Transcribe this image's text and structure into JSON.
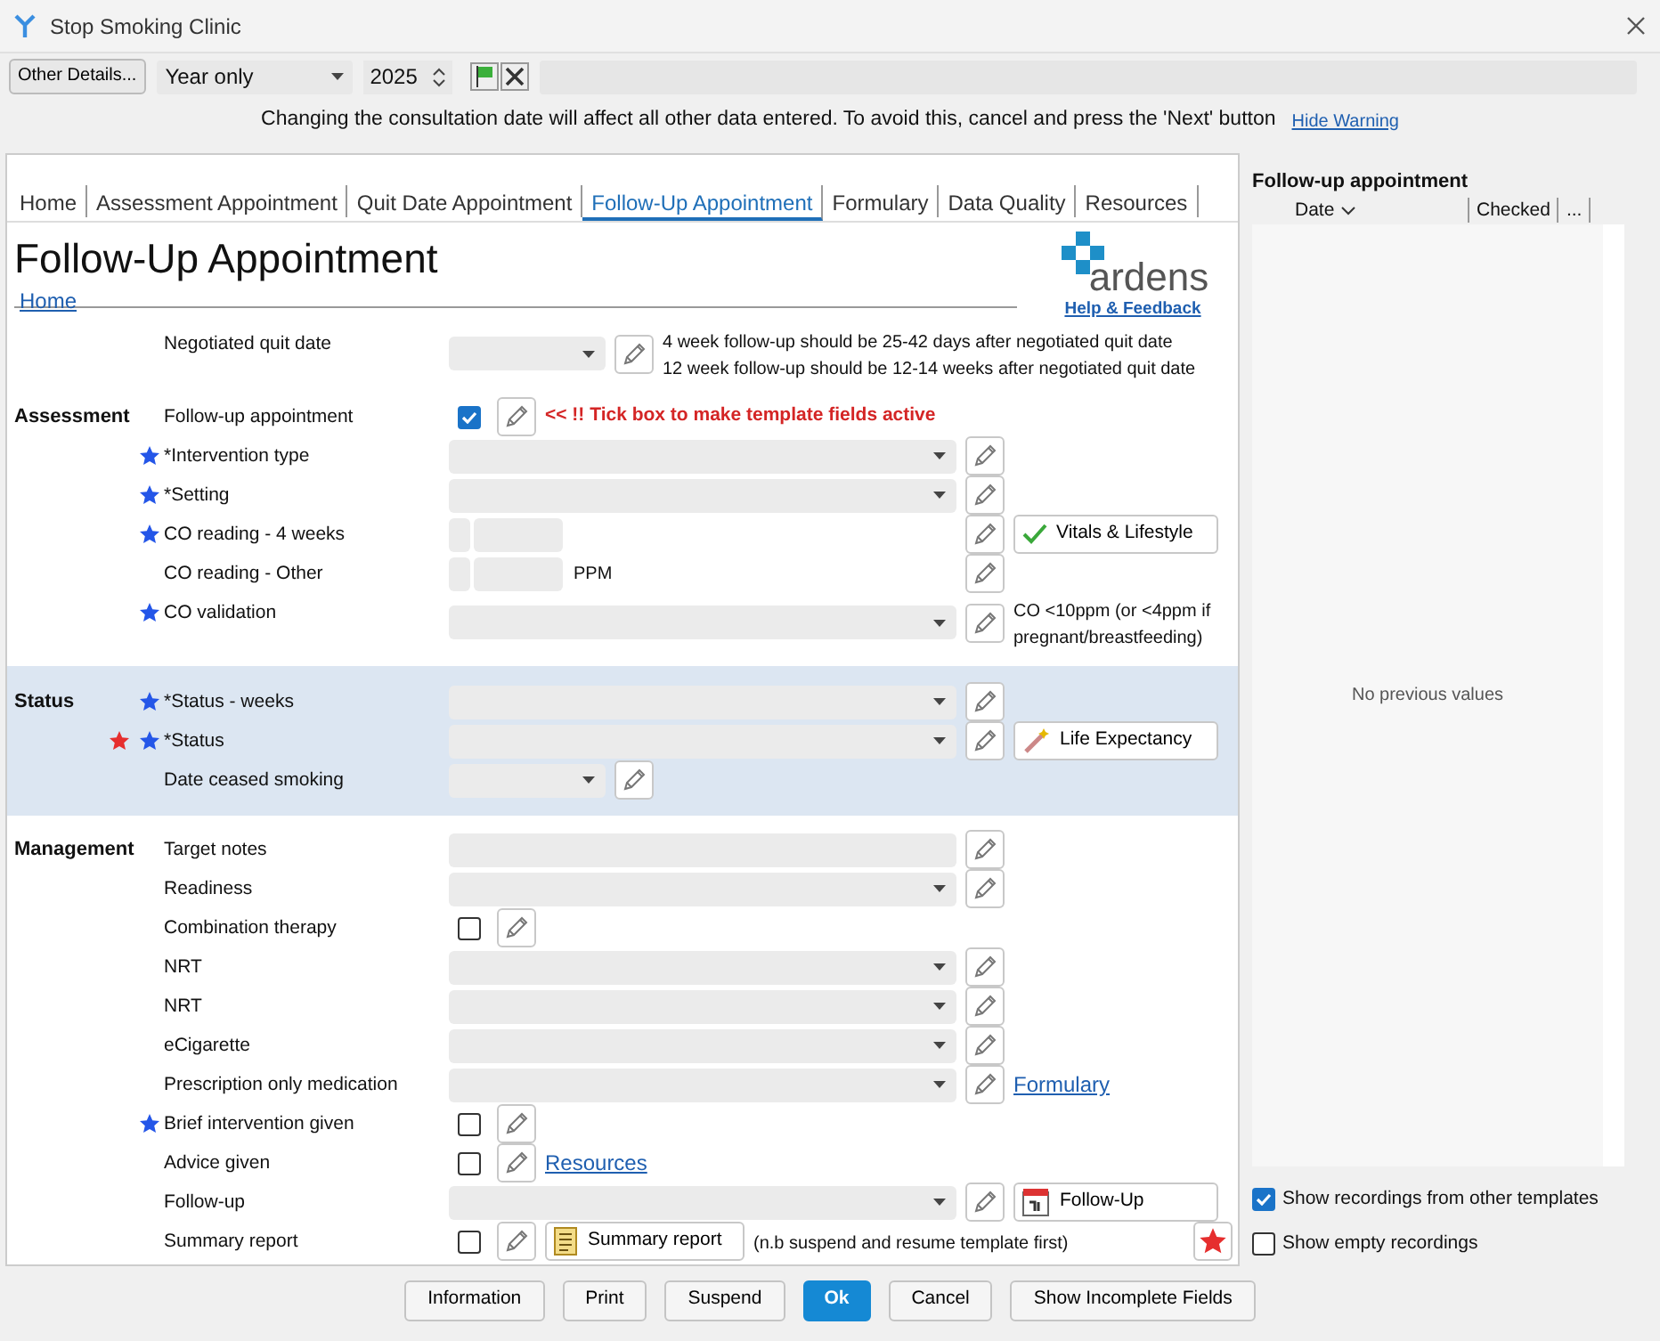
{
  "window": {
    "title": "Stop Smoking Clinic"
  },
  "toolbar": {
    "details_button": "Other Details...",
    "date_mode": "Year only",
    "year": "2025",
    "warning": "Changing the consultation date will affect all other data entered. To avoid this, cancel and press the 'Next' button",
    "hide_warning": "Hide Warning"
  },
  "tabs": [
    {
      "label": "Home",
      "selected": false
    },
    {
      "label": "Assessment Appointment",
      "selected": false
    },
    {
      "label": "Quit Date Appointment",
      "selected": false
    },
    {
      "label": "Follow-Up Appointment",
      "selected": true
    },
    {
      "label": "Formulary",
      "selected": false
    },
    {
      "label": "Data Quality",
      "selected": false
    },
    {
      "label": "Resources",
      "selected": false
    }
  ],
  "header": {
    "title": "Follow-Up Appointment",
    "home_link": "Home",
    "logo_text": "ardens",
    "help_link": "Help & Feedback"
  },
  "sections": [
    {
      "highlighted": false,
      "rows": [
        {
          "label": "Negotiated quit date",
          "kind": "date",
          "required": false,
          "flagged": false,
          "extras": [
            {
              "kind": "note",
              "text": "4 week follow-up should be 25-42 days after negotiated quit date\n12 week follow-up should be 12-14 weeks after negotiated quit date"
            }
          ]
        }
      ]
    },
    {
      "title": "Assessment",
      "highlighted": false,
      "rows": [
        {
          "label": "Follow-up appointment",
          "kind": "checkbox",
          "checked": true,
          "required": false,
          "flagged": false,
          "extras": [
            {
              "kind": "warning",
              "text": "<< !! Tick box to make template fields active"
            }
          ]
        },
        {
          "label": "*Intervention type",
          "kind": "select",
          "required": true,
          "flagged": false
        },
        {
          "label": "*Setting",
          "kind": "select",
          "required": true,
          "flagged": false
        },
        {
          "label": "CO reading - 4 weeks",
          "kind": "number",
          "required": true,
          "flagged": false,
          "extras": [
            {
              "kind": "button",
              "text": "Vitals & Lifestyle"
            }
          ]
        },
        {
          "label": "CO reading - Other",
          "kind": "number",
          "unit": "PPM",
          "required": false,
          "flagged": false
        },
        {
          "label": "CO validation",
          "kind": "select",
          "required": true,
          "flagged": false,
          "extras": [
            {
              "kind": "note",
              "text": "CO <10ppm (or <4ppm if\npregnant/breastfeeding)"
            }
          ]
        }
      ]
    },
    {
      "title": "Status",
      "highlighted": true,
      "rows": [
        {
          "label": "*Status - weeks",
          "kind": "select",
          "required": true,
          "flagged": false
        },
        {
          "label": "*Status",
          "kind": "select",
          "required": true,
          "flagged": true,
          "extras": [
            {
              "kind": "button",
              "text": "Life Expectancy"
            }
          ]
        },
        {
          "label": "Date ceased smoking",
          "kind": "date",
          "required": false,
          "flagged": false
        }
      ]
    },
    {
      "title": "Management",
      "highlighted": false,
      "rows": [
        {
          "label": "Target notes",
          "kind": "text",
          "required": false,
          "flagged": false
        },
        {
          "label": "Readiness",
          "kind": "select",
          "required": false,
          "flagged": false
        },
        {
          "label": "Combination therapy",
          "kind": "checkbox",
          "checked": false,
          "required": false,
          "flagged": false
        },
        {
          "label": "NRT",
          "kind": "select",
          "required": false,
          "flagged": false
        },
        {
          "label": "NRT",
          "kind": "select",
          "required": false,
          "flagged": false
        },
        {
          "label": "eCigarette",
          "kind": "select",
          "required": false,
          "flagged": false
        },
        {
          "label": "Prescription only medication",
          "kind": "select",
          "required": false,
          "flagged": false,
          "extras": [
            {
              "kind": "link",
              "text": "Formulary"
            }
          ]
        },
        {
          "label": "Brief intervention given",
          "kind": "checkbox",
          "checked": false,
          "required": true,
          "flagged": false
        },
        {
          "label": "Advice given",
          "kind": "checkbox",
          "checked": false,
          "required": false,
          "flagged": false,
          "extras": [
            {
              "kind": "link",
              "text": "Resources"
            }
          ]
        },
        {
          "label": "Follow-up",
          "kind": "select",
          "required": false,
          "flagged": false,
          "extras": [
            {
              "kind": "button",
              "text": "Follow-Up"
            }
          ]
        },
        {
          "label": "Summary report",
          "kind": "checkbox",
          "checked": false,
          "required": false,
          "flagged": false,
          "extras": [
            {
              "kind": "button",
              "text": "Summary report"
            },
            {
              "kind": "note",
              "text": "(n.b suspend and resume template first)"
            },
            {
              "kind": "star"
            }
          ]
        }
      ]
    }
  ],
  "history": {
    "title": "Follow-up appointment",
    "columns": [
      "Date",
      "Checked",
      "..."
    ],
    "empty_text": "No previous values",
    "options": [
      {
        "label": "Show recordings from other templates",
        "checked": true
      },
      {
        "label": "Show empty recordings",
        "checked": false
      }
    ]
  },
  "buttons": [
    {
      "label": "Information",
      "primary": false
    },
    {
      "label": "Print",
      "primary": false
    },
    {
      "label": "Suspend",
      "primary": false
    },
    {
      "label": "Ok",
      "primary": true
    },
    {
      "label": "Cancel",
      "primary": false
    },
    {
      "label": "Show Incomplete Fields",
      "primary": false
    }
  ]
}
